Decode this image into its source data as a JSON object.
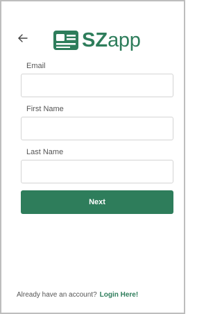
{
  "header": {
    "back_icon": "back-arrow-icon",
    "logo": {
      "text_bold": "SZ",
      "text_regular": "app",
      "icon": "id-card-icon",
      "color": "#2e7d5b"
    }
  },
  "form": {
    "email": {
      "label": "Email",
      "value": ""
    },
    "first_name": {
      "label": "First Name",
      "value": ""
    },
    "last_name": {
      "label": "Last Name",
      "value": ""
    },
    "next_label": "Next"
  },
  "footer": {
    "prompt": "Already have an account?",
    "login_link": "Login Here!"
  },
  "colors": {
    "accent": "#2e7d5b",
    "border": "#d4d4d4",
    "text": "#555555"
  }
}
